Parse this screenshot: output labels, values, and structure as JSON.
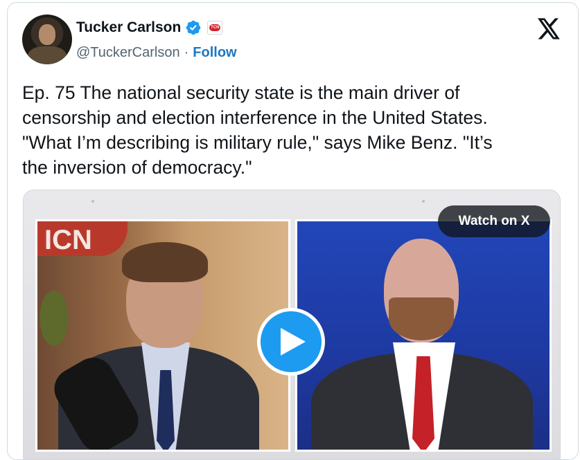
{
  "author": {
    "name": "Tucker Carlson",
    "handle": "@TuckerCarlson",
    "separator": "·",
    "follow_label": "Follow",
    "verified_color": "#1d9bf0",
    "affiliation_badge": "TCN"
  },
  "platform": {
    "logo_icon": "x-logo-icon"
  },
  "tweet": {
    "text": "Ep. 75  The national security state is the main driver of\ncensorship and election interference in the United States.\n\"What I’m describing is military rule,\" says Mike Benz. \"It’s\nthe inversion of democracy.\""
  },
  "media": {
    "watch_label": "Watch on X",
    "play_icon": "play-icon",
    "left_sign_text": "ICN"
  },
  "colors": {
    "accent": "#1d9bf0",
    "follow_link": "#1d76c2",
    "text_primary": "#0f1419",
    "text_secondary": "#536471"
  }
}
